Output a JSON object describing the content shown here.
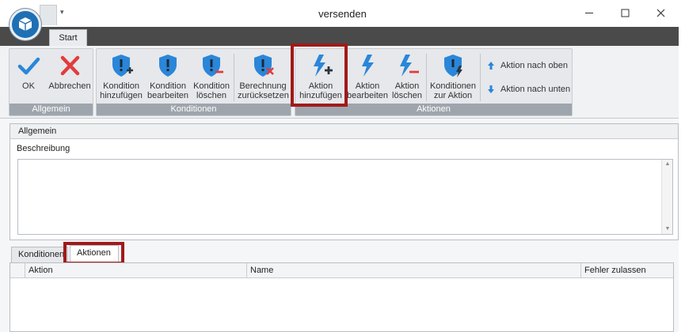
{
  "window": {
    "title": "versenden",
    "qat_arrow": "▾",
    "controls": {
      "minimize": "—",
      "maximize": "☐",
      "close": "✕"
    }
  },
  "ribbon": {
    "tabs": [
      {
        "label": "Start"
      }
    ],
    "groups": {
      "allgemein": {
        "label": "Allgemein",
        "ok_label": "OK",
        "cancel_label": "Abbrechen"
      },
      "konditionen": {
        "label": "Konditionen",
        "add": [
          "Kondition",
          "hinzufügen"
        ],
        "edit": [
          "Kondition",
          "bearbeiten"
        ],
        "delete": [
          "Kondition",
          "löschen"
        ],
        "reset": [
          "Berechnung",
          "zurücksetzen"
        ]
      },
      "aktionen": {
        "label": "Aktionen",
        "add": [
          "Aktion",
          "hinzufügen"
        ],
        "edit": [
          "Aktion",
          "bearbeiten"
        ],
        "delete": [
          "Aktion",
          "löschen"
        ],
        "conditions": [
          "Konditionen",
          "zur Aktion"
        ],
        "move_up": "Aktion nach oben",
        "move_down": "Aktion nach unten"
      }
    }
  },
  "general_panel": {
    "header": "Allgemein",
    "description_label": "Beschreibung",
    "description_value": ""
  },
  "bottom_tabs": [
    {
      "label": "Konditionen",
      "active": false
    },
    {
      "label": "Aktionen",
      "active": true
    }
  ],
  "grid": {
    "columns": [
      "Aktion",
      "Name",
      "Fehler zulassen"
    ],
    "rows": []
  },
  "colors": {
    "accent_blue": "#2a86d9",
    "delete_red": "#e23c3c",
    "highlight_red": "#a11a1a",
    "group_label_bg": "#9ea5ad"
  }
}
